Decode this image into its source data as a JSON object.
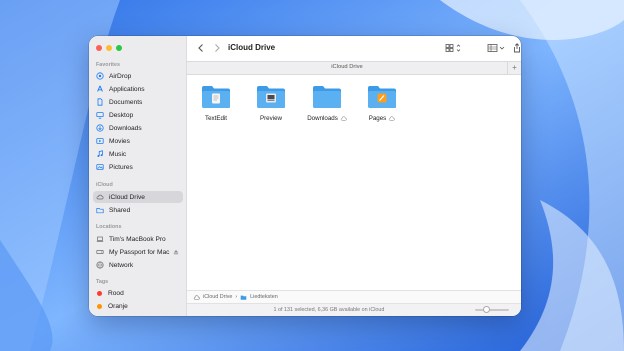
{
  "window": {
    "title": "iCloud Drive",
    "tab_label": "iCloud Drive",
    "tab_add": "+"
  },
  "sidebar": {
    "favorites_title": "Favorites",
    "favorites": [
      {
        "label": "AirDrop",
        "icon": "airdrop-icon"
      },
      {
        "label": "Applications",
        "icon": "applications-icon"
      },
      {
        "label": "Documents",
        "icon": "document-icon"
      },
      {
        "label": "Desktop",
        "icon": "desktop-icon"
      },
      {
        "label": "Downloads",
        "icon": "download-icon"
      },
      {
        "label": "Movies",
        "icon": "movie-icon"
      },
      {
        "label": "Music",
        "icon": "music-icon"
      },
      {
        "label": "Pictures",
        "icon": "pictures-icon"
      }
    ],
    "icloud_title": "iCloud",
    "icloud": [
      {
        "label": "iCloud Drive",
        "icon": "cloud-icon",
        "selected": true
      },
      {
        "label": "Shared",
        "icon": "shared-folder-icon"
      }
    ],
    "locations_title": "Locations",
    "locations": [
      {
        "label": "Tim's MacBook Pro",
        "icon": "laptop-icon"
      },
      {
        "label": "My Passport for Mac",
        "icon": "external-drive-icon"
      },
      {
        "label": "Network",
        "icon": "network-icon"
      }
    ],
    "tags_title": "Tags",
    "tags": [
      {
        "label": "Rood",
        "color": "#ff3b30"
      },
      {
        "label": "Oranje",
        "color": "#ff9500"
      }
    ]
  },
  "files": [
    {
      "label": "TextEdit",
      "badge": "textedit-icon"
    },
    {
      "label": "Preview",
      "badge": "preview-icon"
    },
    {
      "label": "Downloads",
      "badge": "",
      "cloud": true
    },
    {
      "label": "Pages",
      "badge": "pages-icon",
      "cloud": true
    }
  ],
  "pathbar": {
    "root": "iCloud Drive",
    "separator": "›",
    "current": "Liedteksten"
  },
  "status": {
    "text": "1 of 131 selected, 6,36 GB available on iCloud",
    "zoom_level": 0.3
  },
  "colors": {
    "accent": "#1a7cf5",
    "folder": "#5ab0f0",
    "folder_dark": "#3d9ae6"
  }
}
